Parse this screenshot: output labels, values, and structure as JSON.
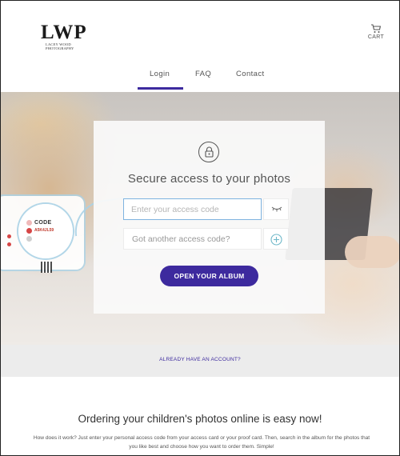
{
  "brand": {
    "logo_text": "LWP",
    "logo_subtitle_line1": "LACEY WOOD",
    "logo_subtitle_line2": "PHOTOGRAPHY"
  },
  "header": {
    "cart_label": "CART",
    "cart_icon": "cart-icon"
  },
  "nav": {
    "items": [
      {
        "label": "Login",
        "active": true
      },
      {
        "label": "FAQ",
        "active": false
      },
      {
        "label": "Contact",
        "active": false
      }
    ],
    "active_color": "#3d2a9e"
  },
  "hero_card": {
    "code_title": "CODE",
    "code_value": "A5K4JL59"
  },
  "login": {
    "lock_icon": "lock-icon",
    "title": "Secure access to your photos",
    "access_code_placeholder": "Enter your access code",
    "access_code_value": "",
    "eye_icon": "eye-closed-icon",
    "another_code_label": "Got another access code?",
    "plus_icon": "plus-circle-icon",
    "open_button_label": "OPEN YOUR ALBUM",
    "button_color": "#3d2a9e"
  },
  "account": {
    "link_label": "ALREADY HAVE AN ACCOUNT?"
  },
  "promo": {
    "title": "Ordering your children's photos online is easy now!",
    "text": "How does it work? Just enter your personal access code from your access card or your proof card. Then, search in the album for the photos that you like best and choose how you want to order them. Simple!"
  }
}
